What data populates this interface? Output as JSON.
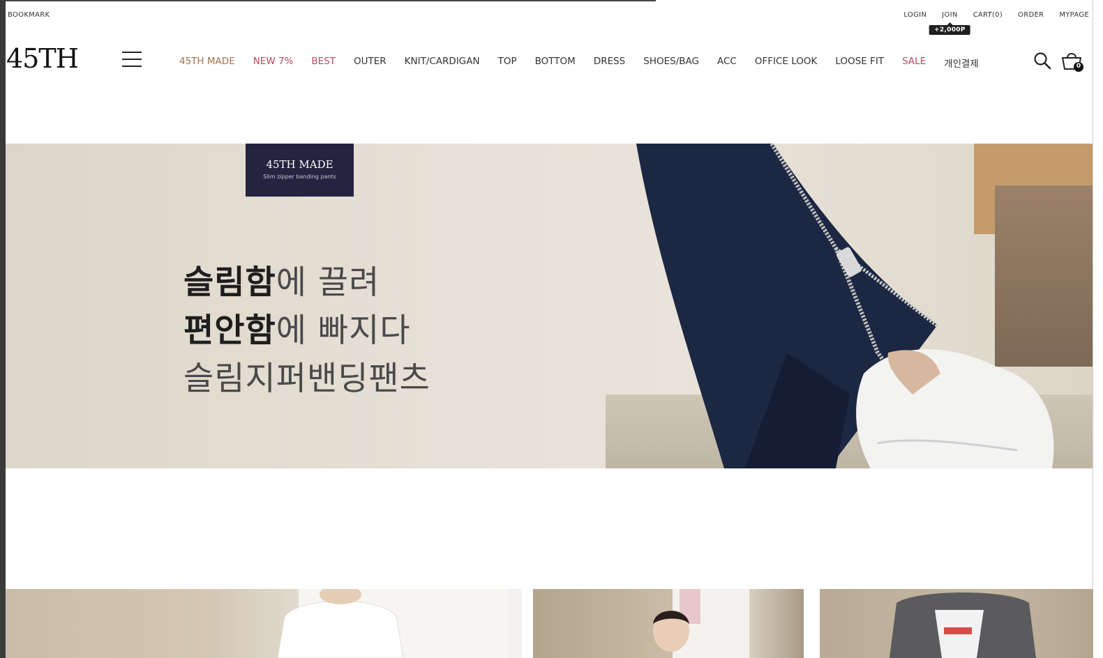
{
  "topbar": {
    "bookmark": "BOOKMARK",
    "login": "LOGIN",
    "join": "JOIN",
    "join_badge": "+2,000P",
    "cart": "CART(0)",
    "order": "ORDER",
    "mypage": "MYPAGE"
  },
  "logo": "45TH",
  "nav": [
    "45TH MADE",
    "NEW 7%",
    "BEST",
    "OUTER",
    "KNIT/CARDIGAN",
    "TOP",
    "BOTTOM",
    "DRESS",
    "SHOES/BAG",
    "ACC",
    "OFFICE LOOK",
    "LOOSE FIT",
    "SALE",
    "개인결제"
  ],
  "cart_count": "0",
  "hero": {
    "sticker_title": "45TH MADE",
    "sticker_sub": "Slim zipper banding pants",
    "line1_bold": "슬림함",
    "line1_rest": "에 끌려",
    "line2_bold": "편안함",
    "line2_rest": "에 빠지다",
    "line3": "슬림지퍼밴딩팬츠"
  },
  "colors": {
    "nav_brown": "#a0724a",
    "nav_rose": "#b64a5a",
    "sticker_bg": "#242440",
    "pants_navy": "#1c2742"
  },
  "icons": [
    "hamburger-icon",
    "search-icon",
    "shopping-bag-icon"
  ]
}
